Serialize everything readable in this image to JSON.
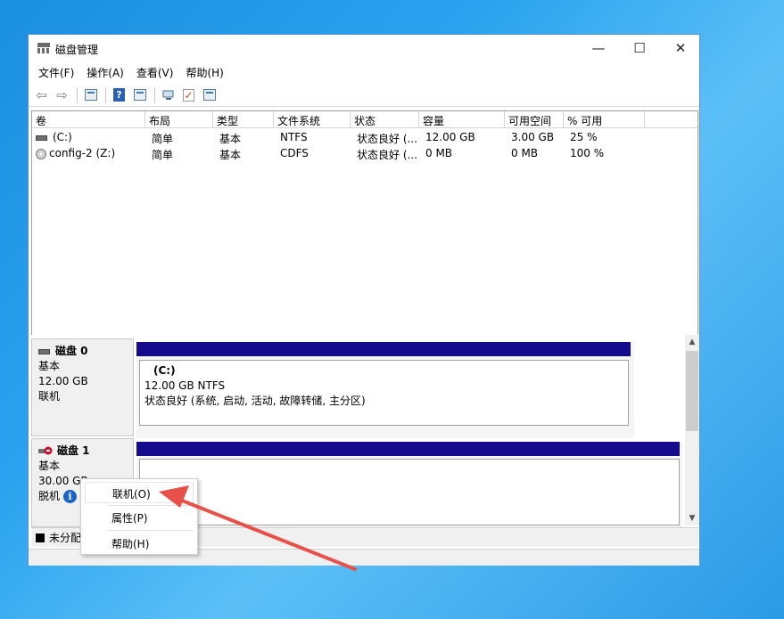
{
  "window": {
    "title": "磁盘管理",
    "controls": {
      "minimize": "—",
      "maximize": "☐",
      "close": "✕"
    }
  },
  "menu": [
    "文件(F)",
    "操作(A)",
    "查看(V)",
    "帮助(H)"
  ],
  "toolbar": {
    "icons": [
      "back-arrow-icon",
      "forward-arrow-icon",
      "console-tree-icon",
      "help-icon",
      "properties-icon",
      "connect-icon",
      "check-icon",
      "list-view-icon"
    ],
    "back_glyph": "⇦",
    "forward_glyph": "⇨",
    "help_glyph": "?",
    "check_glyph": "✓"
  },
  "volume_table": {
    "columns": [
      "卷",
      "布局",
      "类型",
      "文件系统",
      "状态",
      "容量",
      "可用空间",
      "% 可用"
    ],
    "rows": [
      {
        "volume": "(C:)",
        "layout": "简单",
        "type": "基本",
        "fs": "NTFS",
        "status": "状态良好 (...",
        "capacity": "12.00 GB",
        "free": "3.00 GB",
        "pct": "25 %",
        "icon": "drive-icon"
      },
      {
        "volume": "config-2 (Z:)",
        "layout": "简单",
        "type": "基本",
        "fs": "CDFS",
        "status": "状态良好 (...",
        "capacity": "0 MB",
        "free": "0 MB",
        "pct": "100 %",
        "icon": "cd-drive-icon"
      }
    ]
  },
  "disks": [
    {
      "name": "磁盘 0",
      "kind": "基本",
      "size": "12.00 GB",
      "state": "联机",
      "partition": {
        "label": "(C:)",
        "size_fs": "12.00 GB NTFS",
        "status": "状态良好 (系统, 启动, 活动, 故障转储, 主分区)"
      }
    },
    {
      "name": "磁盘 1",
      "kind": "基本",
      "size": "30.00 GB",
      "state": "脱机",
      "state_icon": "info-icon",
      "state_glyph": "i"
    }
  ],
  "legend": {
    "unallocated": "未分配"
  },
  "context_menu": {
    "items": [
      "联机(O)",
      "属性(P)",
      "帮助(H)"
    ],
    "highlighted": "联机(O)"
  },
  "colors": {
    "partition_bar": "#140c8c",
    "annotation_arrow": "#e8504a"
  }
}
